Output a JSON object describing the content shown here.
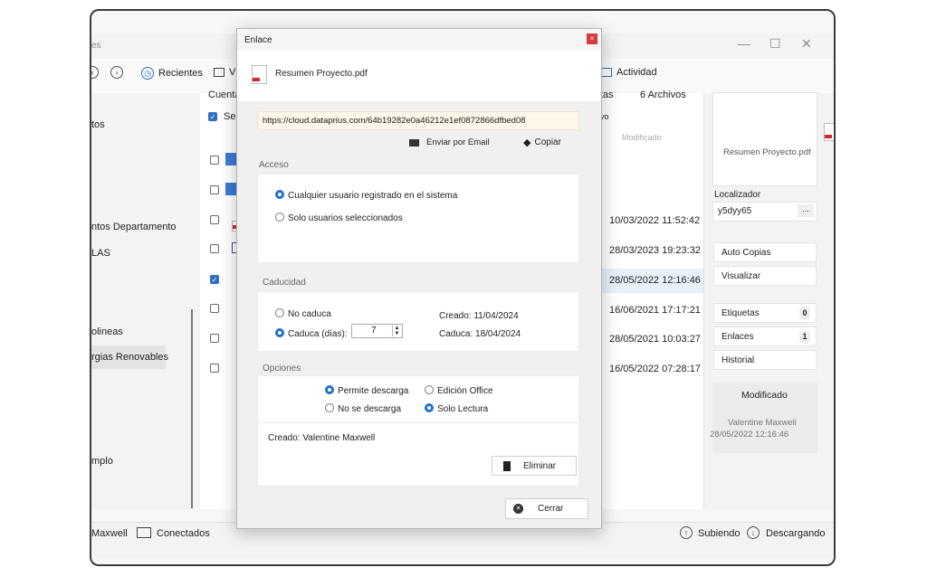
{
  "colors": {
    "accent": "#1f6fcf",
    "pdf_red": "#d7262c",
    "close_red": "#d83b3b",
    "url_bg": "#fdf6e9"
  },
  "main_window": {
    "title_partial": "es",
    "toolbar": {
      "recientes": "Recientes",
      "v_partial": "V",
      "actividad": "Actividad"
    },
    "filelist": {
      "col_cuenta": "Cuenta",
      "col_sel": "Sel",
      "col_tas": "tas",
      "archivos": "6 Archivos",
      "col_vo": "vo",
      "col_modificado": "Modificado"
    },
    "sidebar": [
      {
        "label": "tos"
      },
      {
        "label": "ntos Departamento"
      },
      {
        "label": "LAS"
      },
      {
        "label": "olineas"
      },
      {
        "label": "rgias Renovables"
      },
      {
        "label": "mplo"
      }
    ],
    "dates": [
      "10/03/2022 11:52:42",
      "28/03/2023 19:23:32",
      "28/05/2022 12:16:46",
      "16/06/2021 17:17:21",
      "28/05/2021 10:03:27",
      "16/05/2022 07:28:17"
    ],
    "right_panel": {
      "file_name": "Resumen Proyecto.pdf",
      "localizador_label": "Localizador",
      "localizador_value": "y5dyy65",
      "more": "...",
      "auto_copias": "Auto Copias",
      "visualizar": "Visualizar",
      "etiquetas": "Etiquetas",
      "etiquetas_count": "0",
      "enlaces": "Enlaces",
      "enlaces_count": "1",
      "historial": "Historial",
      "modificado": "Modificado",
      "mod_user": "Valentine Maxwell",
      "mod_date": "28/05/2022 12:16:46"
    },
    "status": {
      "user_partial": "Maxwell",
      "conectados": "Conectados",
      "subiendo": "Subiendo",
      "descargando": "Descargando"
    }
  },
  "dialog": {
    "title": "Enlace",
    "close": "×",
    "file_name": "Resumen Proyecto.pdf",
    "url": "https://cloud.dataprius.com/64b19282e0a46212e1ef0872866dfbed08",
    "email": "Enviar por Email",
    "copy": "Copiar",
    "acceso": "Acceso",
    "acceso_opt1": "Cualquier usuario registrado en el sistema",
    "acceso_opt2": "Solo usuarios seleccionados",
    "caducidad": "Caducidad",
    "no_caduca": "No caduca",
    "caduca_dias": "Caduca (días):",
    "dias": "7",
    "creado_fecha": "Creado: 11/04/2024",
    "caduca_fecha": "Caduca: 18/04/2024",
    "opciones": "Opciones",
    "permite_descarga": "Permite descarga",
    "no_se_descarga": "No se descarga",
    "edicion_office": "Edición Office",
    "solo_lectura": "Solo Lectura",
    "creado_por": "Creado:  Valentine Maxwell",
    "eliminar": "Eliminar",
    "cerrar": "Cerrar"
  }
}
